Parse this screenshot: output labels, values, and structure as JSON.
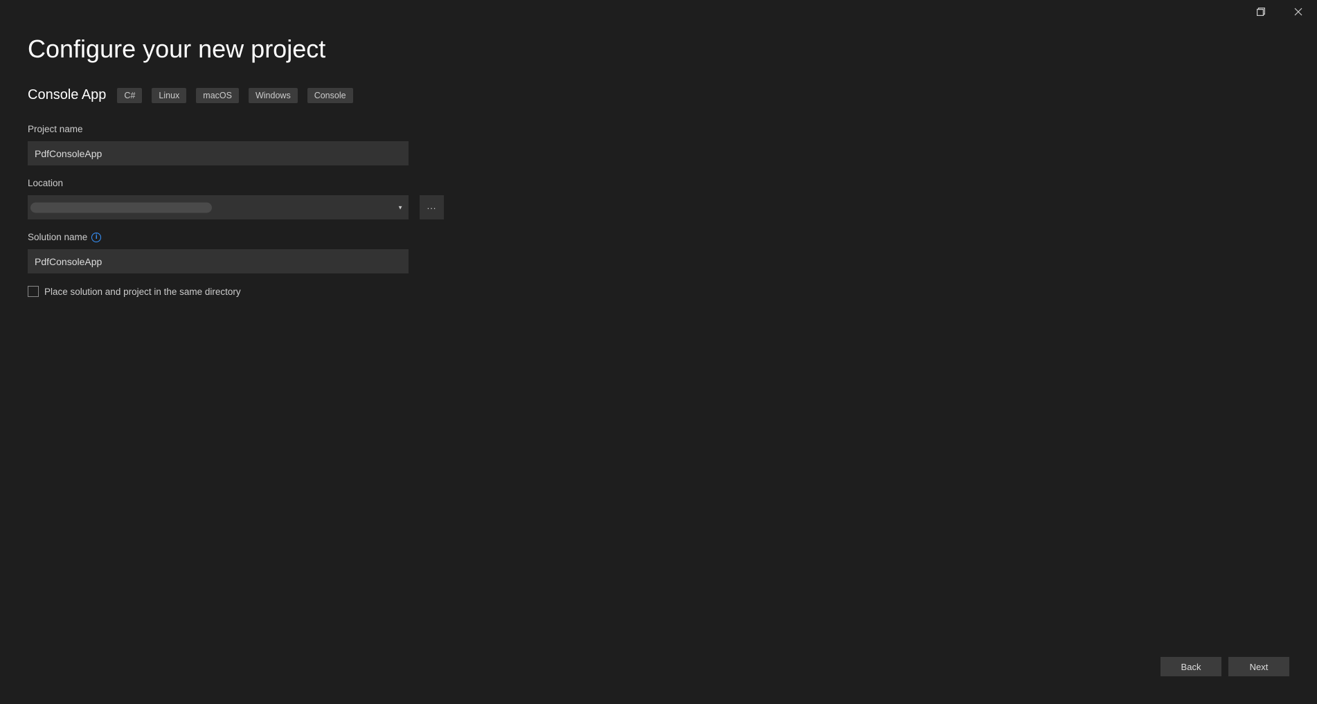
{
  "titlebar": {
    "maximize_icon": "maximize",
    "close_icon": "close"
  },
  "header": {
    "title": "Configure your new project",
    "template_name": "Console App",
    "tags": [
      "C#",
      "Linux",
      "macOS",
      "Windows",
      "Console"
    ]
  },
  "fields": {
    "project_name": {
      "label": "Project name",
      "value": "PdfConsoleApp"
    },
    "location": {
      "label": "Location",
      "value": "",
      "browse_label": "..."
    },
    "solution_name": {
      "label": "Solution name",
      "value": "PdfConsoleApp"
    },
    "same_dir_checkbox": {
      "label": "Place solution and project in the same directory",
      "checked": false
    }
  },
  "footer": {
    "back_label": "Back",
    "next_label": "Next"
  }
}
